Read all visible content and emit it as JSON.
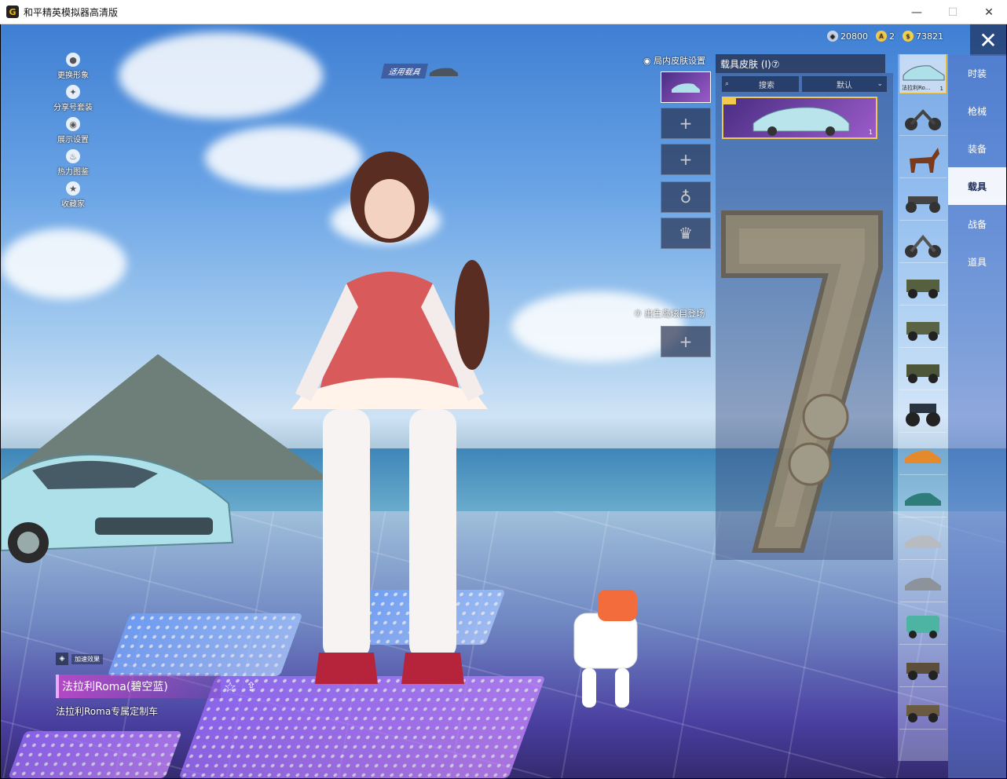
{
  "window": {
    "title": "和平精英模拟器高清版",
    "icon": "G",
    "minimize": "—",
    "maximize": "☐",
    "close": "✕"
  },
  "left_menu": [
    {
      "label": "更换形象",
      "icon": "person-icon",
      "glyph": "●"
    },
    {
      "label": "分享号套装",
      "icon": "share-icon",
      "glyph": "✦"
    },
    {
      "label": "展示设置",
      "icon": "eye-icon",
      "glyph": "◉"
    },
    {
      "label": "热力图鉴",
      "icon": "flame-icon",
      "glyph": "♨"
    },
    {
      "label": "收藏家",
      "icon": "collector-icon",
      "glyph": "★"
    }
  ],
  "apply_vehicle": "适用载具",
  "currencies": [
    {
      "value": "20800",
      "color": "#c9d3e6",
      "glyph": "◆"
    },
    {
      "value": "2",
      "color": "#f2c94c",
      "glyph": "A"
    },
    {
      "value": "73821",
      "color": "#f2d24c",
      "glyph": "$"
    }
  ],
  "close_glyph": "✕",
  "tabs": [
    {
      "label": "时装",
      "active": false
    },
    {
      "label": "枪械",
      "active": false
    },
    {
      "label": "装备",
      "active": false
    },
    {
      "label": "载具",
      "active": true
    },
    {
      "label": "战备",
      "active": false
    },
    {
      "label": "道具",
      "active": false
    }
  ],
  "vehicle_list": {
    "selected": {
      "name": "法拉利Ro...",
      "count": "1"
    }
  },
  "skin_panel": {
    "title": "载具皮肤 (I)⑦",
    "search_placeholder": "搜索",
    "search_glyph": "⌕",
    "sort": "默认",
    "sort_glyph": "⌄",
    "card_count": "1"
  },
  "ingame": {
    "label": "◉ 局内皮肤设置",
    "plus": "+",
    "lock_glyph": "♁",
    "crown_glyph": "♛"
  },
  "spawn": {
    "label": "⑦ 出生岛炫目登场",
    "plus": "+"
  },
  "bottom_info": {
    "badge_glyph": "◈",
    "badge": "加速效果",
    "vehicle_name": "法拉利Roma(碧空蓝)",
    "description": "法拉利Roma专属定制车",
    "fav_glyph": "☆",
    "share_glyph": "⇪"
  }
}
